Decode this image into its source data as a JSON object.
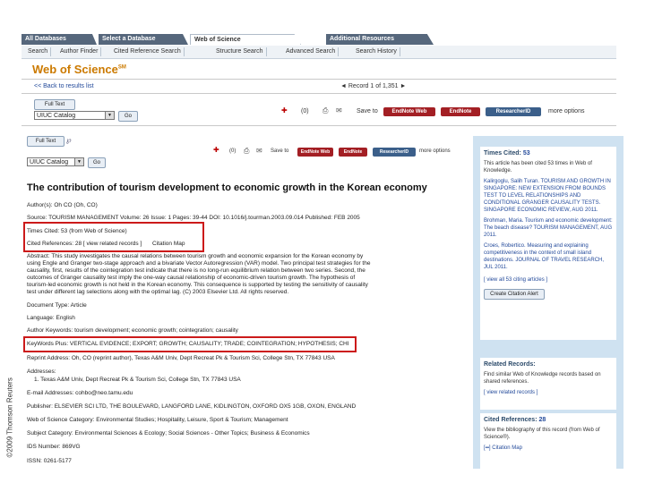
{
  "copyright": "©2009 Thomson Reuters",
  "tabs": [
    "All Databases",
    "Select a Database",
    "Web of Science",
    "Additional Resources"
  ],
  "subnav": [
    "Search",
    "Author Finder",
    "Cited Reference Search",
    "Structure Search",
    "Advanced Search",
    "Search History"
  ],
  "brand": {
    "name": "Web of Science",
    "mark": "SM"
  },
  "back_link": "<< Back to results list",
  "record_nav": "◄  Record 1 of 1,351  ►",
  "toolbar_top": {
    "full_text": "Full Text",
    "catalog": "UIUC Catalog",
    "go": "Go",
    "count": "(0)",
    "save_to": "Save to",
    "endnote_web": "EndNote Web",
    "endnote": "EndNote",
    "researcher_id": "ResearcherID",
    "more": "more options"
  },
  "toolbar_second": {
    "full_text": "Full Text",
    "catalog": "UIUC Catalog",
    "go": "Go",
    "count": "(0)",
    "save_to": "Save to",
    "endnote_web": "EndNote Web",
    "endnote": "EndNote",
    "researcher_id": "ResearcherID",
    "more": "more options"
  },
  "article": {
    "title": "The contribution of tourism development to economic growth in the Korean economy",
    "authors": "Author(s): Oh CO (Oh, CO)",
    "source": "Source: TOURISM MANAGEMENT  Volume: 26  Issue: 1  Pages: 39-44  DOI: 10.1016/j.tourman.2003.09.014  Published: FEB 2005",
    "times_cited": "Times Cited: 53 (from Web of Science)",
    "cited_refs": "Cited References: 28  [ view related records ]",
    "citation_map": "Citation Map",
    "abstract": "Abstract: This study investigates the causal relations between tourism growth and economic expansion for the Korean economy by using Engle and Granger two-stage approach and a bivariate Vector Autoregression (VAR) model. Two principal test strategies for the causality, first, results of the cointegration test indicate that there is no long-run equilibrium relation between two series. Second, the outcomes of Granger causality test imply the one-way causal relationship of economic-driven tourism growth. The hypothesis of tourism-led economic growth is not held in the Korean economy. This consequence is supported by testing the sensitivity of causality test under different lag selections along with the optimal lag. (C) 2003 Elsevier Ltd. All rights reserved.",
    "doc_type": "Document Type: Article",
    "language": "Language: English",
    "author_keywords": "Author Keywords: tourism development; economic growth; cointegration; causality",
    "keywords_plus": "KeyWords Plus: VERTICAL EVIDENCE; EXPORT; GROWTH; CAUSALITY; TRADE; COINTEGRATION; HYPOTHESIS; CHINA",
    "reprint": "Reprint Address: Oh, CO (reprint author), Texas A&M Univ, Dept Recreat Pk & Tourism Sci, College Stn, TX 77843 USA",
    "addresses_h": "Addresses:",
    "address_1": "1. Texas A&M Univ, Dept Recreat Pk & Tourism Sci, College Stn, TX 77843 USA",
    "email": "E-mail Addresses: cohbo@neo.tamu.edu",
    "publisher": "Publisher: ELSEVIER SCI LTD, THE BOULEVARD, LANGFORD LANE, KIDLINGTON, OXFORD OX5 1GB, OXON, ENGLAND",
    "categories": "Web of Science Category: Environmental Studies; Hospitality, Leisure, Sport & Tourism; Management",
    "subject": "Subject Category: Environmental Sciences & Ecology; Social Sciences - Other Topics; Business & Economics",
    "ids": "IDS Number: 869VG",
    "issn": "ISSN: 0261-5177"
  },
  "sidebar": {
    "times_cited_label": "Times Cited:",
    "times_cited_value": "53",
    "times_cited_text": "This article has been cited 53 times in Web of Knowledge.",
    "citing_1": "Kalirgoglu, Salih Turan. TOURISM AND GROWTH IN SINGAPORE: NEW EXTENSION FROM BOUNDS TEST TO LEVEL RELATIONSHIPS AND CONDITIONAL GRANGER CAUSALITY TESTS. SINGAPORE ECONOMIC REVIEW, AUG 2011.",
    "citing_2": "Brohman, Maria. Tourism and economic development: The beach disease? TOURISM MANAGEMENT, AUG 2011.",
    "citing_3": "Croes, Robertico. Measuring and explaining competitiveness in the context of small island destinations. JOURNAL OF TRAVEL RESEARCH, JUL 2011.",
    "view_all": "[ view all 53 citing articles ]",
    "alert_btn": "Create Citation Alert",
    "related_h": "Related Records:",
    "related_t": "Find similar Web of Knowledge records based on shared references.",
    "related_link": "[ view related records ]",
    "cited_refs_h": "Cited References:",
    "cited_refs_n": "28",
    "cited_refs_t": "View the bibliography of this record (from Web of Science®).",
    "citation_map": "Citation Map"
  }
}
